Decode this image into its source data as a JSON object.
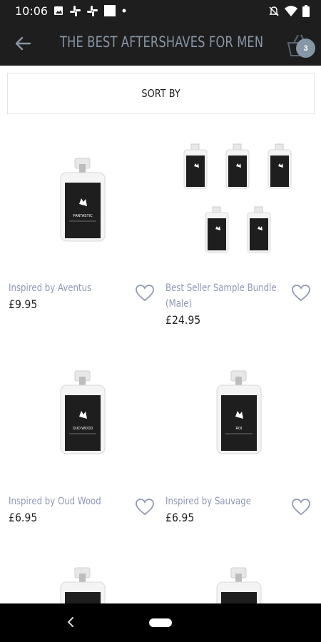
{
  "status_bar": {
    "time": "10:06"
  },
  "app_bar": {
    "title": "THE BEST AFTERSHAVES FOR MEN",
    "cart_count": "3"
  },
  "sort": {
    "label": "SORT BY"
  },
  "products": [
    {
      "name": "Inspired by  Aventus",
      "price": "£9.95",
      "bottle_label": "FANTASTIC"
    },
    {
      "name_line1": "Best Seller Sample Bundle",
      "name_line2": "(Male)",
      "price": "£24.95"
    },
    {
      "name": "Inspired by  Oud Wood",
      "price": "£6.95",
      "bottle_label": "OUD WOOD"
    },
    {
      "name": "Inspired by  Sauvage",
      "price": "£6.95",
      "bottle_label": "ROI"
    }
  ],
  "colors": {
    "bar": "#1e1e1e",
    "title": "#8896a6",
    "product_name": "#8f98b4",
    "badge": "#8596a6"
  }
}
